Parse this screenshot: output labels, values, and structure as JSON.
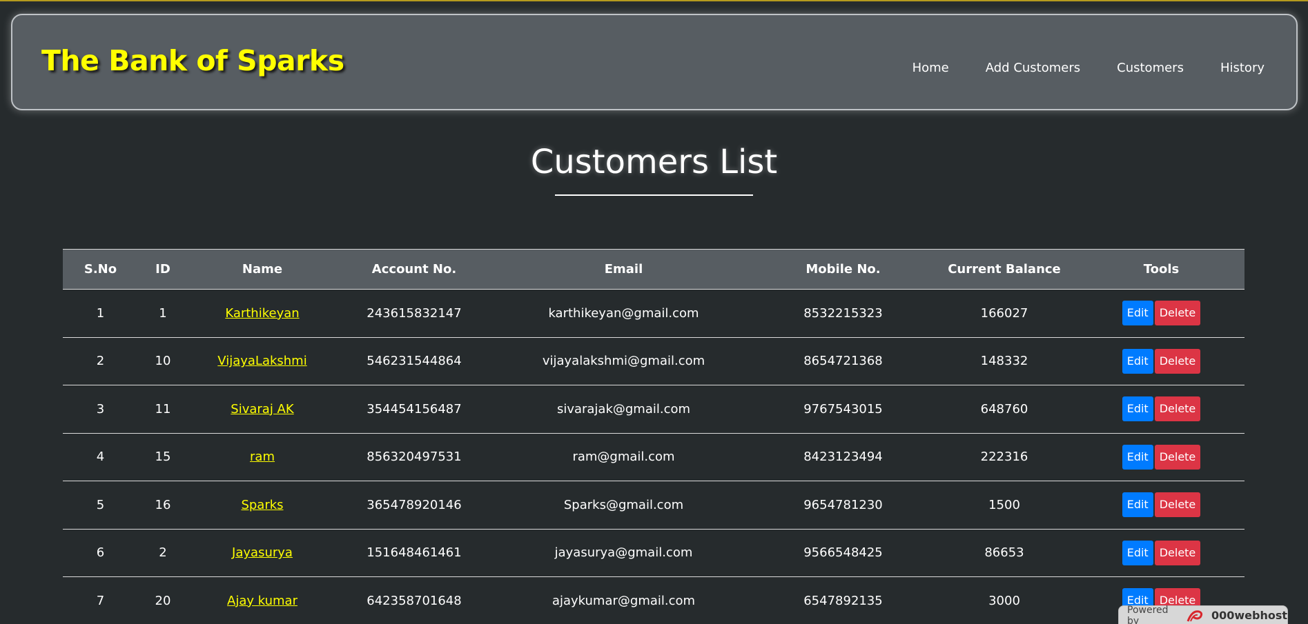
{
  "header": {
    "brand": "The Bank of Sparks",
    "nav": [
      "Home",
      "Add Customers",
      "Customers",
      "History"
    ]
  },
  "page_title": "Customers List",
  "table": {
    "columns": [
      "S.No",
      "ID",
      "Name",
      "Account No.",
      "Email",
      "Mobile No.",
      "Current Balance",
      "Tools"
    ],
    "rows": [
      [
        "1",
        "1",
        "Karthikeyan",
        "243615832147",
        "karthikeyan@gmail.com",
        "8532215323",
        "166027"
      ],
      [
        "2",
        "10",
        "VijayaLakshmi",
        "546231544864",
        "vijayalakshmi@gmail.com",
        "8654721368",
        "148332"
      ],
      [
        "3",
        "11",
        "Sivaraj AK",
        "354454156487",
        "sivarajak@gmail.com",
        "9767543015",
        "648760"
      ],
      [
        "4",
        "15",
        "ram",
        "856320497531",
        "ram@gmail.com",
        "8423123494",
        "222316"
      ],
      [
        "5",
        "16",
        "Sparks",
        "365478920146",
        "Sparks@gmail.com",
        "9654781230",
        "1500"
      ],
      [
        "6",
        "2",
        "Jayasurya",
        "151648461461",
        "jayasurya@gmail.com",
        "9566548425",
        "86653"
      ],
      [
        "7",
        "20",
        "Ajay kumar",
        "642358701648",
        "ajaykumar@gmail.com",
        "6547892135",
        "3000"
      ]
    ],
    "edit_label": "Edit",
    "delete_label": "Delete"
  },
  "footer_badge": {
    "prefix": "Powered by",
    "brand": "000webhost",
    "icon": "000webhost-logo-icon"
  },
  "colors": {
    "background": "#262b2d",
    "header_bg": "#575d62",
    "brand": "#ffff00",
    "link": "#ffff00",
    "edit": "#007bff",
    "delete": "#dc3545"
  }
}
